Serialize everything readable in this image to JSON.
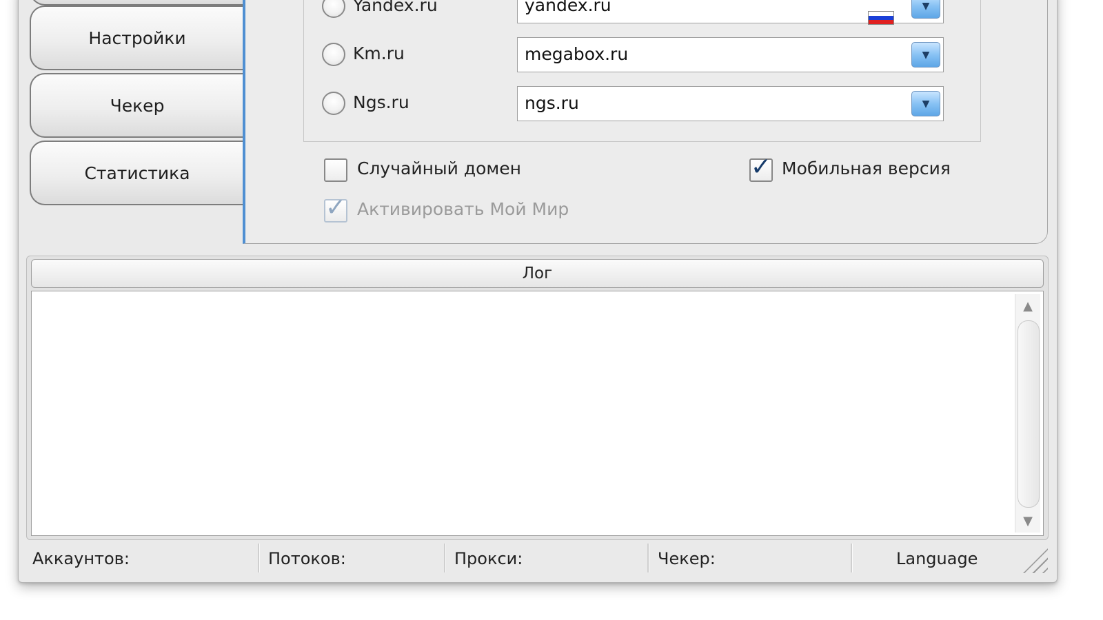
{
  "sidebar": {
    "items": [
      {
        "label": ""
      },
      {
        "label": "Настройки"
      },
      {
        "label": "Чекер"
      },
      {
        "label": "Статистика"
      }
    ]
  },
  "domains": [
    {
      "service": "Yandex.ru",
      "domain": "yandex.ru"
    },
    {
      "service": "Km.ru",
      "domain": "megabox.ru"
    },
    {
      "service": "Ngs.ru",
      "domain": "ngs.ru"
    }
  ],
  "options": {
    "random_domain": {
      "label": "Случайный домен",
      "checked": false
    },
    "mobile_version": {
      "label": "Мобильная версия",
      "checked": true
    },
    "activate_my_world": {
      "label": "Активировать Мой Мир",
      "checked": true,
      "disabled": true
    }
  },
  "log": {
    "title": "Лог",
    "content": ""
  },
  "statusbar": {
    "accounts": "Аккаунтов:",
    "threads": "Потоков:",
    "proxy": "Прокси:",
    "checker": "Чекер:",
    "language": "Language"
  },
  "icons": {
    "checkmark": "✓",
    "combo_arrow": "▼",
    "scroll_up": "▲",
    "scroll_down": "▼"
  },
  "colors": {
    "accent": "#4f8fd2",
    "combo_button": "#88c2f4"
  }
}
